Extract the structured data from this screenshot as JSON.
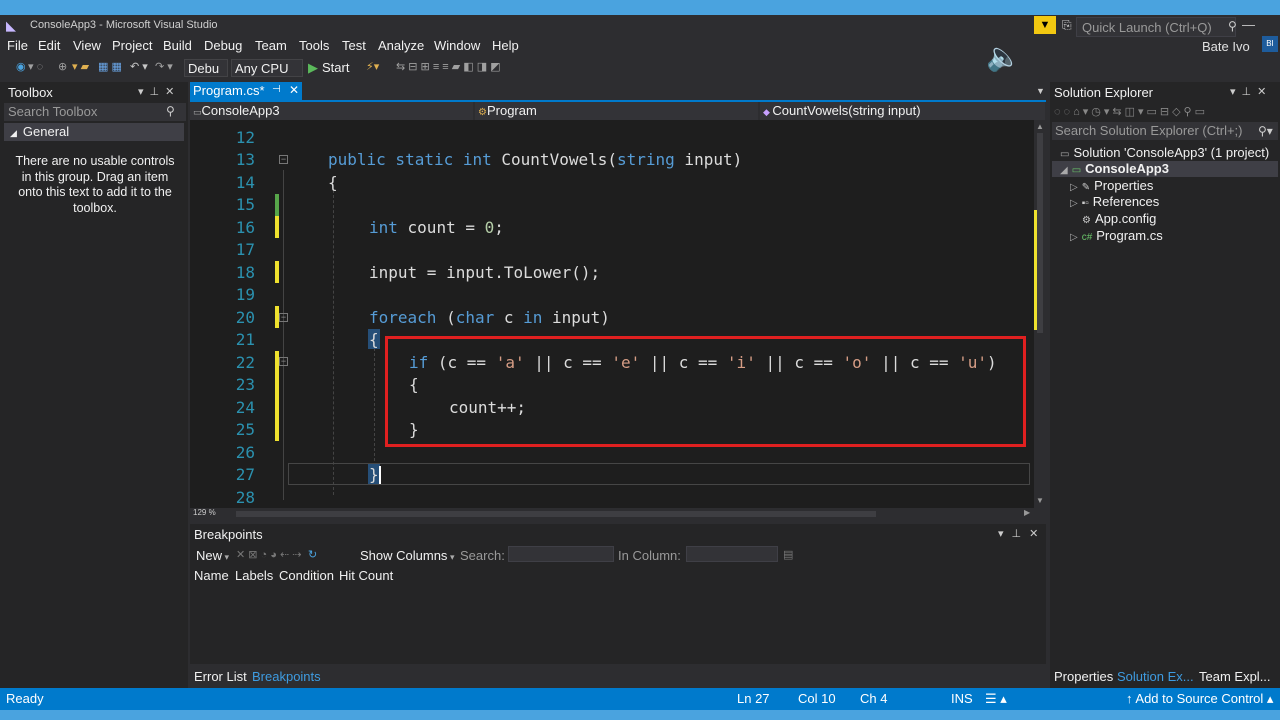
{
  "window": {
    "title": "ConsoleApp3 - Microsoft Visual Studio",
    "quick_launch_placeholder": "Quick Launch (Ctrl+Q)",
    "user": "Bate Ivo",
    "user_initials": "BI"
  },
  "menu": [
    "File",
    "Edit",
    "View",
    "Project",
    "Build",
    "Debug",
    "Team",
    "Tools",
    "Test",
    "Analyze",
    "Window",
    "Help"
  ],
  "toolbar": {
    "configuration": "Debu",
    "platform": "Any CPU",
    "start_label": "Start"
  },
  "toolbox": {
    "title": "Toolbox",
    "search_placeholder": "Search Toolbox",
    "group": "General",
    "empty_message": "There are no usable controls in this group. Drag an item onto this text to add it to the toolbox."
  },
  "editor": {
    "tab_label": "Program.cs*",
    "nav_project": "ConsoleApp3",
    "nav_class": "Program",
    "nav_member": "CountVowels(string input)",
    "zoom": "129 %",
    "lines": [
      {
        "n": "12"
      },
      {
        "n": "13"
      },
      {
        "n": "14"
      },
      {
        "n": "15"
      },
      {
        "n": "16"
      },
      {
        "n": "17"
      },
      {
        "n": "18"
      },
      {
        "n": "19"
      },
      {
        "n": "20"
      },
      {
        "n": "21"
      },
      {
        "n": "22"
      },
      {
        "n": "23"
      },
      {
        "n": "24"
      },
      {
        "n": "25"
      },
      {
        "n": "26"
      },
      {
        "n": "27"
      },
      {
        "n": "28"
      }
    ],
    "code": {
      "l13_kw": "public static int",
      "l13_name": " CountVowels(",
      "l13_kw2": "string",
      "l13_rest": " input)",
      "l14": "{",
      "l16_kw": "int",
      "l16_rest": " count = ",
      "l16_num": "0",
      "l16_end": ";",
      "l18": "input = input.ToLower();",
      "l20_kw": "foreach",
      "l20_a": " (",
      "l20_kw2": "char",
      "l20_b": " c ",
      "l20_kw3": "in",
      "l20_c": " input)",
      "l21": "{",
      "l22_kw": "if",
      "l22_a": " (c == ",
      "l22_s1": "'a'",
      "l22_b": " || c == ",
      "l22_s2": "'e'",
      "l22_c": " || c == ",
      "l22_s3": "'i'",
      "l22_d": " || c == ",
      "l22_s4": "'o'",
      "l22_e": " || c == ",
      "l22_s5": "'u'",
      "l22_f": ")",
      "l23": "{",
      "l24": "count++;",
      "l25": "}",
      "l27": "}"
    }
  },
  "breakpoints": {
    "title": "Breakpoints",
    "new_label": "New",
    "show_columns": "Show Columns",
    "search_label": "Search:",
    "in_column_label": "In Column:",
    "columns": [
      "Name",
      "Labels",
      "Condition",
      "Hit Count"
    ]
  },
  "bottom_tabs": [
    "Error List",
    "Breakpoints"
  ],
  "solution_explorer": {
    "title": "Solution Explorer",
    "search_placeholder": "Search Solution Explorer (Ctrl+;)",
    "solution": "Solution 'ConsoleApp3' (1 project)",
    "project": "ConsoleApp3",
    "items": [
      "Properties",
      "References",
      "App.config",
      "Program.cs"
    ],
    "tabs": [
      "Properties",
      "Solution Ex...",
      "Team Expl..."
    ]
  },
  "status": {
    "ready": "Ready",
    "ln": "Ln 27",
    "col": "Col 10",
    "ch": "Ch 4",
    "mode": "INS",
    "source_control": "↑ Add to Source Control ▴"
  },
  "colors": {
    "accent": "#007acc",
    "keyword": "#569cd6",
    "string": "#d69d85",
    "line_number": "#2b91af",
    "highlight_box": "#e02020"
  }
}
